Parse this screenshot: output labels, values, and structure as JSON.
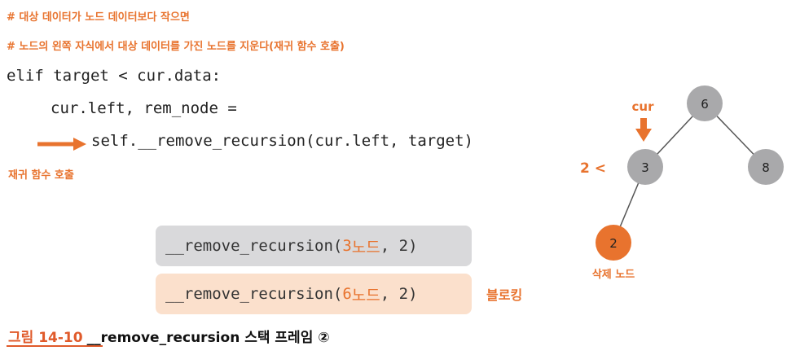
{
  "comments": {
    "line1": "# 대상 데이터가 노드 데이터보다 작으면",
    "line2": "# 노드의 왼쪽 자식에서 대상 데이터를 가진 노드를 지운다(재귀 함수 호출)"
  },
  "code": {
    "line1": "elif target < cur.data:",
    "line2": "cur.left, rem_node =",
    "line3": "self.__remove_recursion(cur.left, target)"
  },
  "recursive_call_label": "재귀 함수 호출",
  "stack": {
    "top_frame": {
      "prefix": "__remove_recursion(",
      "num": "3",
      "node": " 노드",
      "suffix": ", 2)"
    },
    "bottom_frame": {
      "prefix": "__remove_recursion(",
      "num": "6",
      "node": " 노드",
      "suffix": ", 2)"
    },
    "blocking_label": "블로킹"
  },
  "tree": {
    "root": "6",
    "left": "3",
    "right": "8",
    "left_left": "2",
    "cur_label": "cur",
    "compare_label": "2 <",
    "delete_label": "삭제 노드"
  },
  "caption": {
    "number": "그림 14-10",
    "text": "__remove_recursion 스택 프레임 ②"
  },
  "colors": {
    "orange": "#e8732e",
    "gray_node": "#a9a9ab",
    "gray_frame": "#d9d9db",
    "peach_frame": "#fbe0cc"
  }
}
